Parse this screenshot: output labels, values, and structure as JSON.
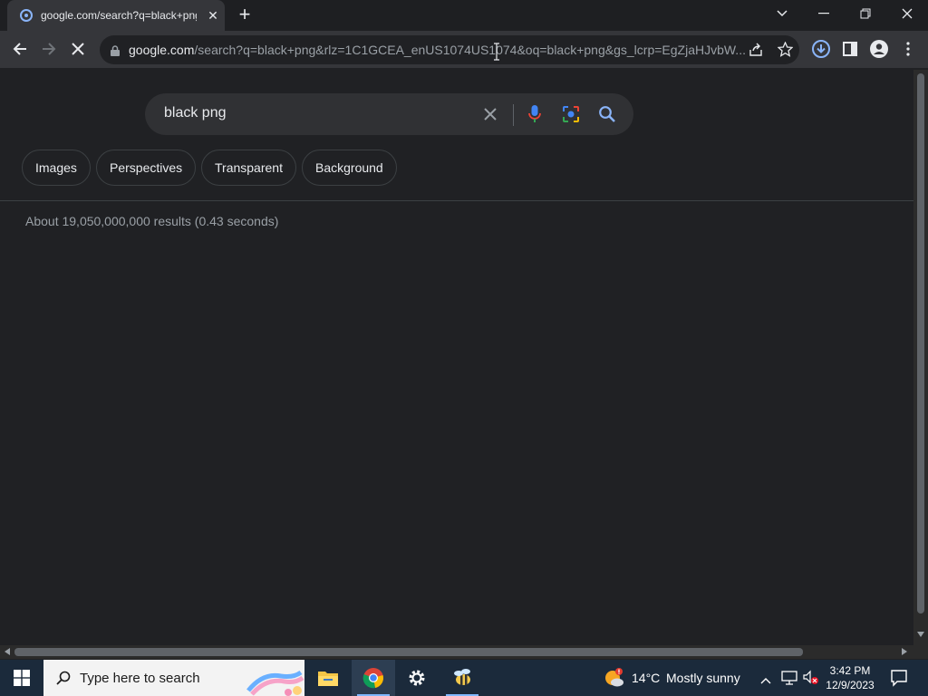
{
  "browser": {
    "tab_title": "google.com/search?q=black+png",
    "url_host": "google.com",
    "url_path": "/search?q=black+png&rlz=1C1GCEA_enUS1074US1074&oq=black+png&gs_lcrp=EgZjaHJvbW..."
  },
  "search": {
    "query": "black png",
    "chips": [
      "Images",
      "Perspectives",
      "Transparent",
      "Background"
    ],
    "results_stats": "About 19,050,000,000 results (0.43 seconds)"
  },
  "taskbar": {
    "search_placeholder": "Type here to search",
    "weather_temp": "14°C",
    "weather_text": "Mostly sunny",
    "time": "3:42 PM",
    "date": "12/9/2023"
  },
  "colors": {
    "background": "#202124",
    "searchbox": "#303134",
    "accent_blue": "#8ab4f8"
  }
}
